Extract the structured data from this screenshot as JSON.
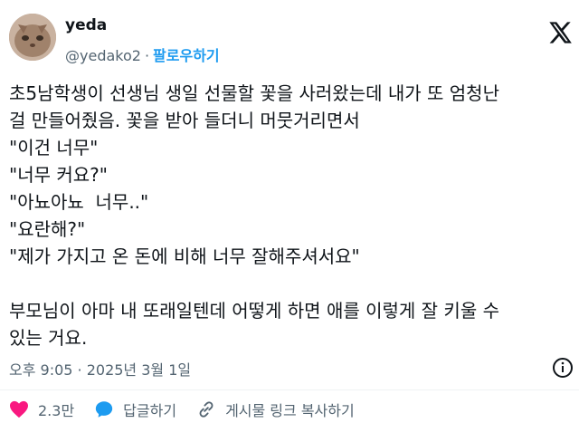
{
  "author": {
    "name": "yeda",
    "handle": "@yedako2",
    "follow_label": "팔로우하기"
  },
  "tweet": {
    "text": "초5남학생이 선생님 생일 선물할 꽃을 사러왔는데 내가 또 엄청난\n걸 만들어줬음. 꽃을 받아 들더니 머뭇거리면서\n\"이건 너무\"\n\"너무 커요?\"\n\"아뇨아뇨  너무..\"\n\"요란해?\"\n\"제가 가지고 온 돈에 비해 너무 잘해주셔서요\"\n\n부모님이 아마 내 또래일텐데 어떻게 하면 애를 이렇게 잘 키울 수\n있는 거요.",
    "timestamp": "오후 9:05 · 2025년 3월 1일"
  },
  "actions": {
    "like_count": "2.3만",
    "reply_label": "답글하기",
    "share_label": "게시물 링크 복사하기"
  },
  "colors": {
    "like": "#f91880",
    "follow": "#1d9bf0",
    "secondary_text": "#536471"
  },
  "icons": [
    "x-logo-icon",
    "info-icon",
    "heart-icon",
    "reply-bubble-icon",
    "link-icon"
  ]
}
